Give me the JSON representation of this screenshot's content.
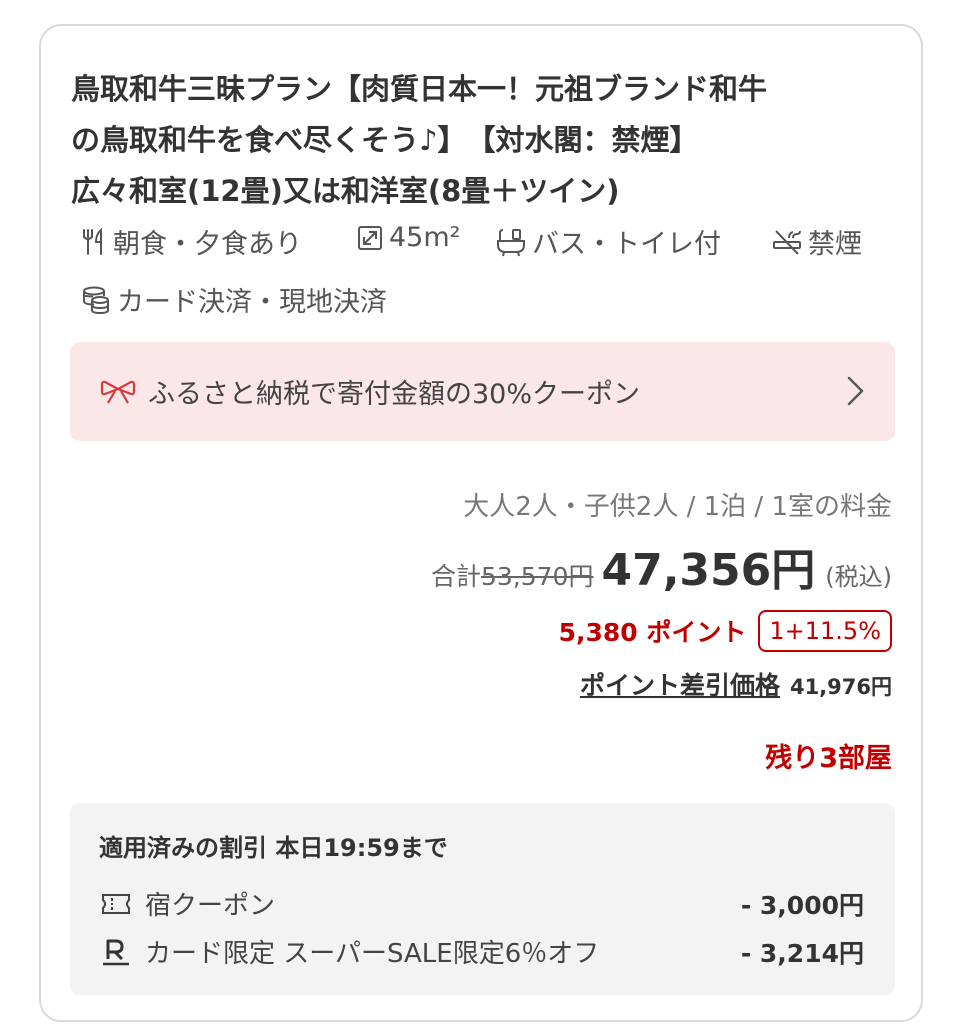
{
  "plan": {
    "title_lines": [
      "鳥取和牛三昧プラン【肉質日本一！元祖ブランド和牛",
      "の鳥取和牛を食べ尽くそう♪】　【対水閣：禁煙】",
      "広々和室(12畳)又は和洋室(8畳＋ツイン)"
    ]
  },
  "amenities": {
    "meals": {
      "icon": "fork-knife-icon",
      "label": "朝食・夕食あり"
    },
    "area": {
      "icon": "expand-arrow-icon",
      "label": "45m²"
    },
    "bath": {
      "icon": "bath-toilet-icon",
      "label": "バス・トイレ付"
    },
    "smoking": {
      "icon": "no-smoking-icon",
      "label": "禁煙"
    },
    "payment": {
      "icon": "coins-icon",
      "label": "カード決済・現地決済"
    }
  },
  "coupon_banner": {
    "icon": "ribbon-icon",
    "text": "ふるさと納税で寄付金額の30%クーポン",
    "accent": "#d83a3a",
    "background": "#fbe7e7"
  },
  "pricing": {
    "occupancy": "大人2人・子供2人 / 1泊 / 1室の料金",
    "total_label": "合計",
    "original_price": "53,570円",
    "price": "47,356円",
    "tax_note": "(税込)",
    "points": "5,380 ポイント",
    "point_rate": "1+11.5%",
    "net_label": "ポイント差引価格",
    "net_price": "41,976円",
    "remaining": "残り3部屋",
    "accent": "#c00000"
  },
  "discounts": {
    "heading": "適用済みの割引 本日19:59まで",
    "items": [
      {
        "icon": "ticket-icon",
        "label": "宿クーポン",
        "amount": "- 3,000円"
      },
      {
        "icon": "rakuten-r-icon",
        "label": "カード限定 スーパーSALE限定6％オフ",
        "amount": "- 3,214円"
      }
    ]
  }
}
